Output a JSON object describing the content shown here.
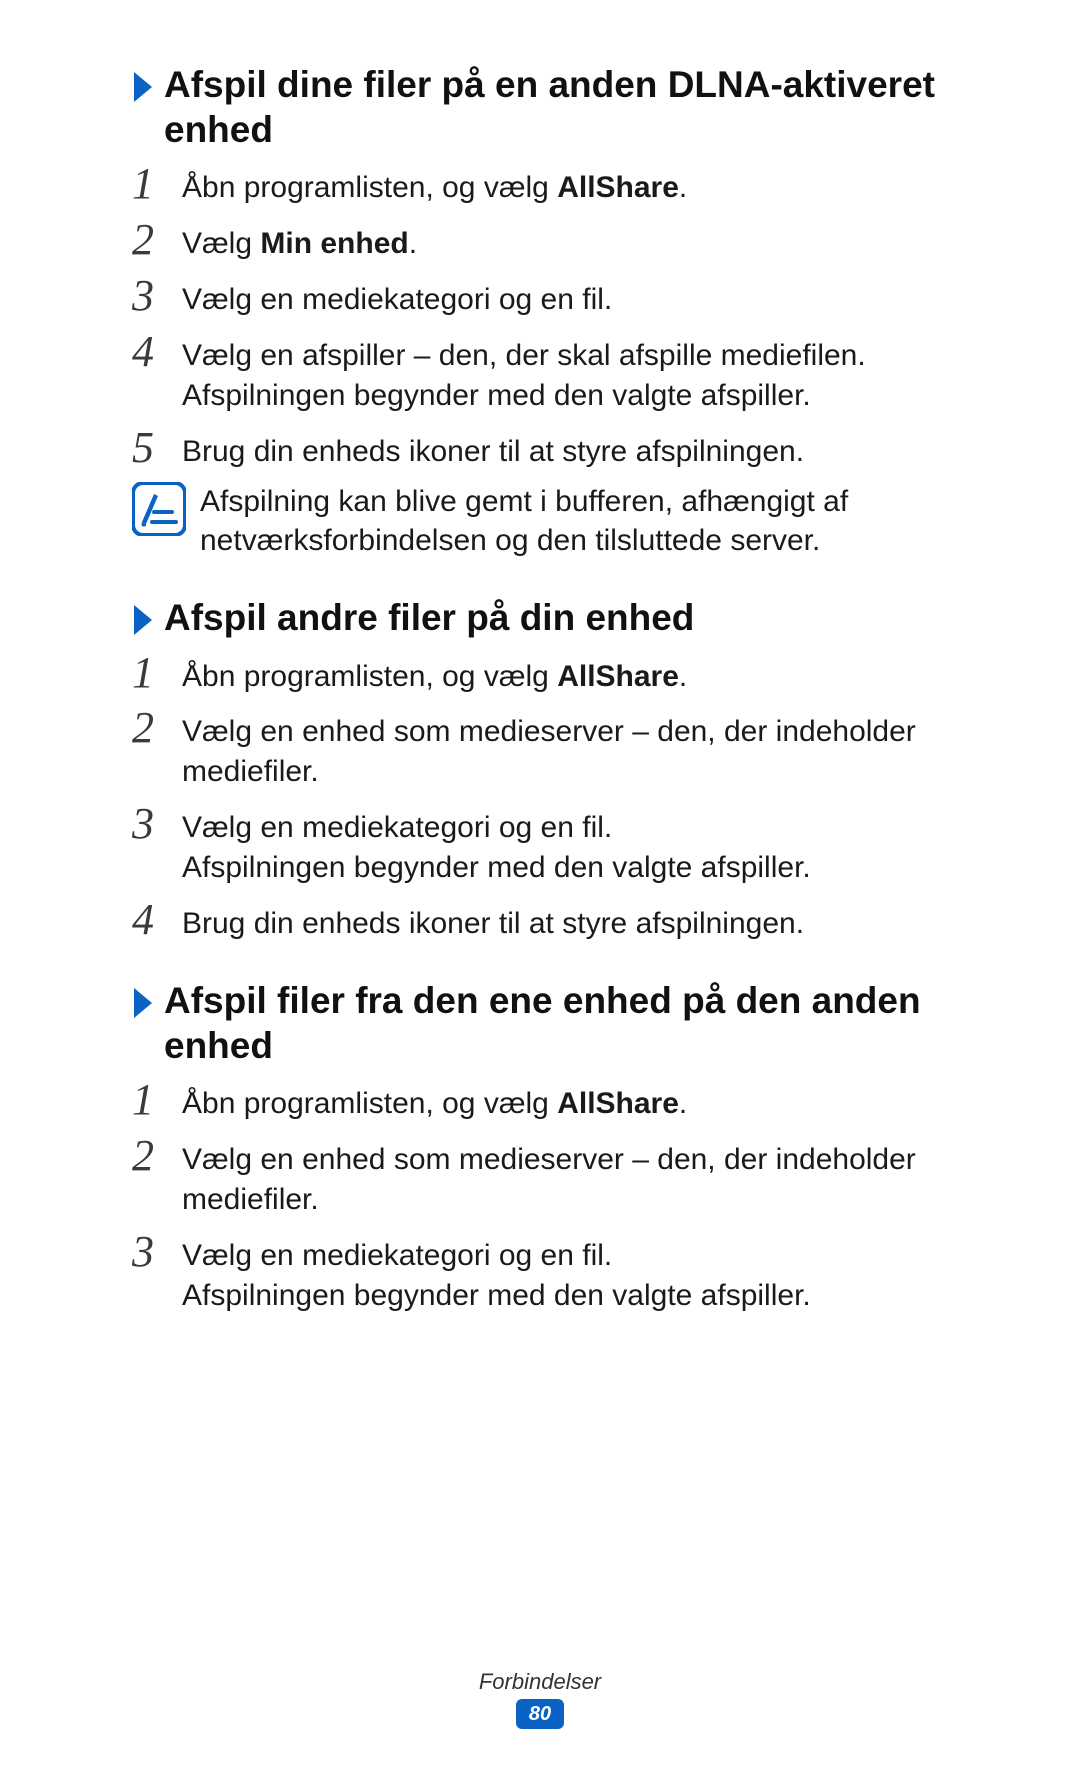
{
  "sections": [
    {
      "heading": "Afspil dine filer på en anden DLNA-aktiveret enhed",
      "steps": [
        {
          "num": "1",
          "lines": [
            {
              "pre": "Åbn programlisten, og vælg ",
              "bold": "AllShare",
              "post": "."
            }
          ]
        },
        {
          "num": "2",
          "lines": [
            {
              "pre": "Vælg ",
              "bold": "Min enhed",
              "post": "."
            }
          ]
        },
        {
          "num": "3",
          "lines": [
            {
              "pre": "Vælg en mediekategori og en fil.",
              "bold": "",
              "post": ""
            }
          ]
        },
        {
          "num": "4",
          "lines": [
            {
              "pre": "Vælg en afspiller – den, der skal afspille mediefilen.",
              "bold": "",
              "post": ""
            },
            {
              "pre": "Afspilningen begynder med den valgte afspiller.",
              "bold": "",
              "post": ""
            }
          ]
        },
        {
          "num": "5",
          "lines": [
            {
              "pre": "Brug din enheds ikoner til at styre afspilningen.",
              "bold": "",
              "post": ""
            }
          ]
        }
      ],
      "note": "Afspilning kan blive gemt i bufferen, afhængigt af netværksforbindelsen og den tilsluttede server."
    },
    {
      "heading": "Afspil andre filer på din enhed",
      "steps": [
        {
          "num": "1",
          "lines": [
            {
              "pre": "Åbn programlisten, og vælg ",
              "bold": "AllShare",
              "post": "."
            }
          ]
        },
        {
          "num": "2",
          "lines": [
            {
              "pre": "Vælg en enhed som medieserver – den, der indeholder mediefiler.",
              "bold": "",
              "post": ""
            }
          ]
        },
        {
          "num": "3",
          "lines": [
            {
              "pre": "Vælg en mediekategori og en fil.",
              "bold": "",
              "post": ""
            },
            {
              "pre": "Afspilningen begynder med den valgte afspiller.",
              "bold": "",
              "post": ""
            }
          ]
        },
        {
          "num": "4",
          "lines": [
            {
              "pre": "Brug din enheds ikoner til at styre afspilningen.",
              "bold": "",
              "post": ""
            }
          ]
        }
      ],
      "note": ""
    },
    {
      "heading": "Afspil filer fra den ene enhed på den anden enhed",
      "steps": [
        {
          "num": "1",
          "lines": [
            {
              "pre": "Åbn programlisten, og vælg ",
              "bold": "AllShare",
              "post": "."
            }
          ]
        },
        {
          "num": "2",
          "lines": [
            {
              "pre": "Vælg en enhed som medieserver – den, der indeholder mediefiler.",
              "bold": "",
              "post": ""
            }
          ]
        },
        {
          "num": "3",
          "lines": [
            {
              "pre": "Vælg en mediekategori og en fil.",
              "bold": "",
              "post": ""
            },
            {
              "pre": "Afspilningen begynder med den valgte afspiller.",
              "bold": "",
              "post": ""
            }
          ]
        }
      ],
      "note": ""
    }
  ],
  "footer": {
    "label": "Forbindelser",
    "page": "80"
  },
  "colors": {
    "accent": "#0a63c4"
  }
}
